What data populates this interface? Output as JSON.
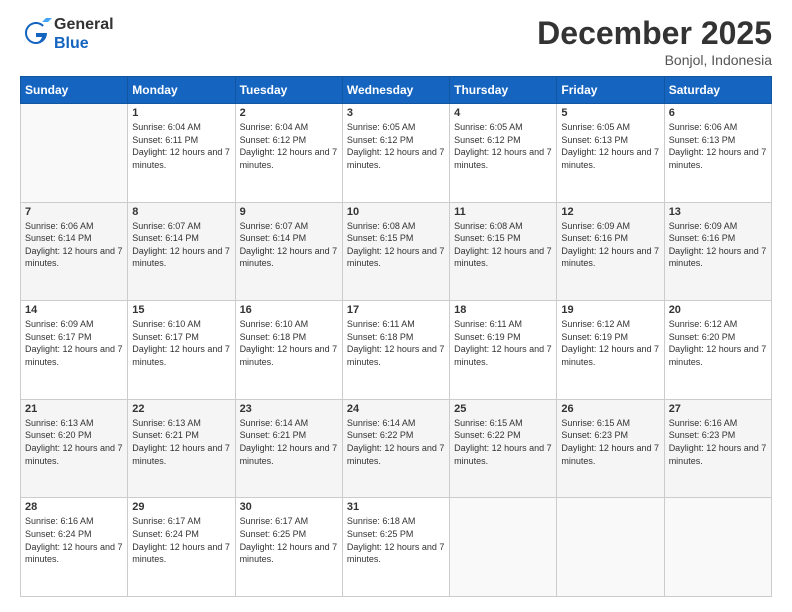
{
  "header": {
    "logo_line1": "General",
    "logo_line2": "Blue",
    "month_title": "December 2025",
    "location": "Bonjol, Indonesia"
  },
  "weekdays": [
    "Sunday",
    "Monday",
    "Tuesday",
    "Wednesday",
    "Thursday",
    "Friday",
    "Saturday"
  ],
  "weeks": [
    [
      {
        "day": "",
        "sunrise": "",
        "sunset": "",
        "daylight": ""
      },
      {
        "day": "1",
        "sunrise": "6:04 AM",
        "sunset": "6:11 PM",
        "daylight": "12 hours and 7 minutes."
      },
      {
        "day": "2",
        "sunrise": "6:04 AM",
        "sunset": "6:12 PM",
        "daylight": "12 hours and 7 minutes."
      },
      {
        "day": "3",
        "sunrise": "6:05 AM",
        "sunset": "6:12 PM",
        "daylight": "12 hours and 7 minutes."
      },
      {
        "day": "4",
        "sunrise": "6:05 AM",
        "sunset": "6:12 PM",
        "daylight": "12 hours and 7 minutes."
      },
      {
        "day": "5",
        "sunrise": "6:05 AM",
        "sunset": "6:13 PM",
        "daylight": "12 hours and 7 minutes."
      },
      {
        "day": "6",
        "sunrise": "6:06 AM",
        "sunset": "6:13 PM",
        "daylight": "12 hours and 7 minutes."
      }
    ],
    [
      {
        "day": "7",
        "sunrise": "6:06 AM",
        "sunset": "6:14 PM",
        "daylight": "12 hours and 7 minutes."
      },
      {
        "day": "8",
        "sunrise": "6:07 AM",
        "sunset": "6:14 PM",
        "daylight": "12 hours and 7 minutes."
      },
      {
        "day": "9",
        "sunrise": "6:07 AM",
        "sunset": "6:14 PM",
        "daylight": "12 hours and 7 minutes."
      },
      {
        "day": "10",
        "sunrise": "6:08 AM",
        "sunset": "6:15 PM",
        "daylight": "12 hours and 7 minutes."
      },
      {
        "day": "11",
        "sunrise": "6:08 AM",
        "sunset": "6:15 PM",
        "daylight": "12 hours and 7 minutes."
      },
      {
        "day": "12",
        "sunrise": "6:09 AM",
        "sunset": "6:16 PM",
        "daylight": "12 hours and 7 minutes."
      },
      {
        "day": "13",
        "sunrise": "6:09 AM",
        "sunset": "6:16 PM",
        "daylight": "12 hours and 7 minutes."
      }
    ],
    [
      {
        "day": "14",
        "sunrise": "6:09 AM",
        "sunset": "6:17 PM",
        "daylight": "12 hours and 7 minutes."
      },
      {
        "day": "15",
        "sunrise": "6:10 AM",
        "sunset": "6:17 PM",
        "daylight": "12 hours and 7 minutes."
      },
      {
        "day": "16",
        "sunrise": "6:10 AM",
        "sunset": "6:18 PM",
        "daylight": "12 hours and 7 minutes."
      },
      {
        "day": "17",
        "sunrise": "6:11 AM",
        "sunset": "6:18 PM",
        "daylight": "12 hours and 7 minutes."
      },
      {
        "day": "18",
        "sunrise": "6:11 AM",
        "sunset": "6:19 PM",
        "daylight": "12 hours and 7 minutes."
      },
      {
        "day": "19",
        "sunrise": "6:12 AM",
        "sunset": "6:19 PM",
        "daylight": "12 hours and 7 minutes."
      },
      {
        "day": "20",
        "sunrise": "6:12 AM",
        "sunset": "6:20 PM",
        "daylight": "12 hours and 7 minutes."
      }
    ],
    [
      {
        "day": "21",
        "sunrise": "6:13 AM",
        "sunset": "6:20 PM",
        "daylight": "12 hours and 7 minutes."
      },
      {
        "day": "22",
        "sunrise": "6:13 AM",
        "sunset": "6:21 PM",
        "daylight": "12 hours and 7 minutes."
      },
      {
        "day": "23",
        "sunrise": "6:14 AM",
        "sunset": "6:21 PM",
        "daylight": "12 hours and 7 minutes."
      },
      {
        "day": "24",
        "sunrise": "6:14 AM",
        "sunset": "6:22 PM",
        "daylight": "12 hours and 7 minutes."
      },
      {
        "day": "25",
        "sunrise": "6:15 AM",
        "sunset": "6:22 PM",
        "daylight": "12 hours and 7 minutes."
      },
      {
        "day": "26",
        "sunrise": "6:15 AM",
        "sunset": "6:23 PM",
        "daylight": "12 hours and 7 minutes."
      },
      {
        "day": "27",
        "sunrise": "6:16 AM",
        "sunset": "6:23 PM",
        "daylight": "12 hours and 7 minutes."
      }
    ],
    [
      {
        "day": "28",
        "sunrise": "6:16 AM",
        "sunset": "6:24 PM",
        "daylight": "12 hours and 7 minutes."
      },
      {
        "day": "29",
        "sunrise": "6:17 AM",
        "sunset": "6:24 PM",
        "daylight": "12 hours and 7 minutes."
      },
      {
        "day": "30",
        "sunrise": "6:17 AM",
        "sunset": "6:25 PM",
        "daylight": "12 hours and 7 minutes."
      },
      {
        "day": "31",
        "sunrise": "6:18 AM",
        "sunset": "6:25 PM",
        "daylight": "12 hours and 7 minutes."
      },
      {
        "day": "",
        "sunrise": "",
        "sunset": "",
        "daylight": ""
      },
      {
        "day": "",
        "sunrise": "",
        "sunset": "",
        "daylight": ""
      },
      {
        "day": "",
        "sunrise": "",
        "sunset": "",
        "daylight": ""
      }
    ]
  ],
  "labels": {
    "sunrise_prefix": "Sunrise: ",
    "sunset_prefix": "Sunset: ",
    "daylight_prefix": "Daylight: "
  }
}
